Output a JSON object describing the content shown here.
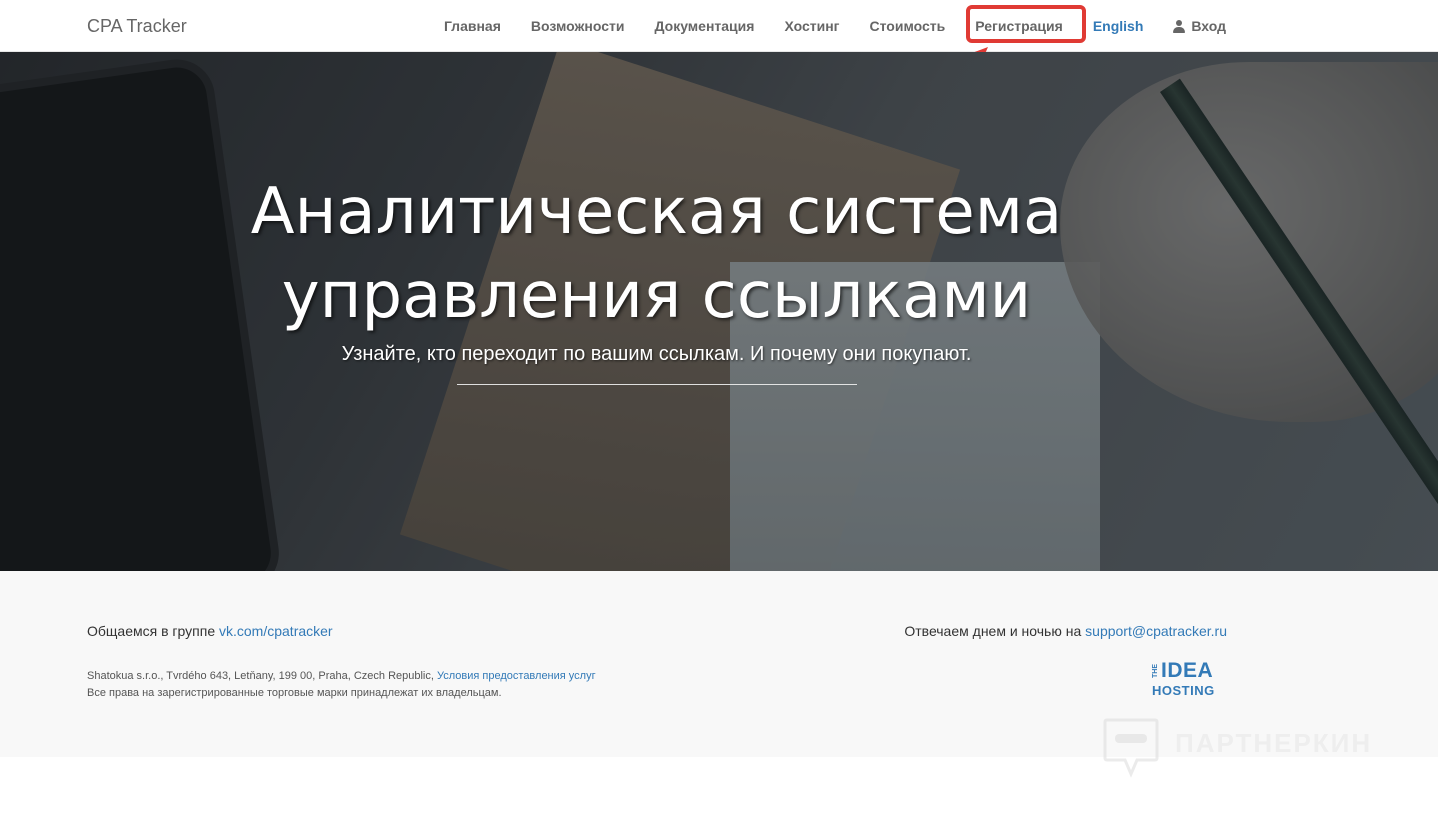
{
  "navbar": {
    "brand": "CPA Tracker",
    "items": [
      {
        "label": "Главная"
      },
      {
        "label": "Возможности"
      },
      {
        "label": "Документация"
      },
      {
        "label": "Хостинг"
      },
      {
        "label": "Стоимость"
      },
      {
        "label": "Регистрация",
        "highlighted": true
      },
      {
        "label": "English"
      },
      {
        "label": "Вход",
        "icon": "user-icon"
      }
    ]
  },
  "hero": {
    "title": "Аналитическая система управления ссылками",
    "subtitle": "Узнайте, кто переходит по вашим ссылкам. И почему они покупают."
  },
  "footer": {
    "community_text": "Общаемся в группе",
    "community_link": "vk.com/cpatracker",
    "support_text": "Отвечаем днем и ночью на",
    "support_link": "support@cpatracker.ru",
    "address": "Shatokua s.r.o., Tvrdého 643, Letňany, 199 00, Praha, Czech Republic,",
    "terms_link": "Условия предоставления услуг",
    "rights": "Все права на зарегистрированные торговые марки принадлежат их владельцам.",
    "hosting_logo": {
      "the": "THE",
      "main": "IDEA",
      "sub": "HOSTING"
    }
  },
  "watermark": {
    "text": "ПАРТНЕРКИН"
  },
  "colors": {
    "link": "#337ab7",
    "annotation": "#e03a34",
    "footer_bg": "#f8f8f8",
    "nav_text": "#666666"
  }
}
